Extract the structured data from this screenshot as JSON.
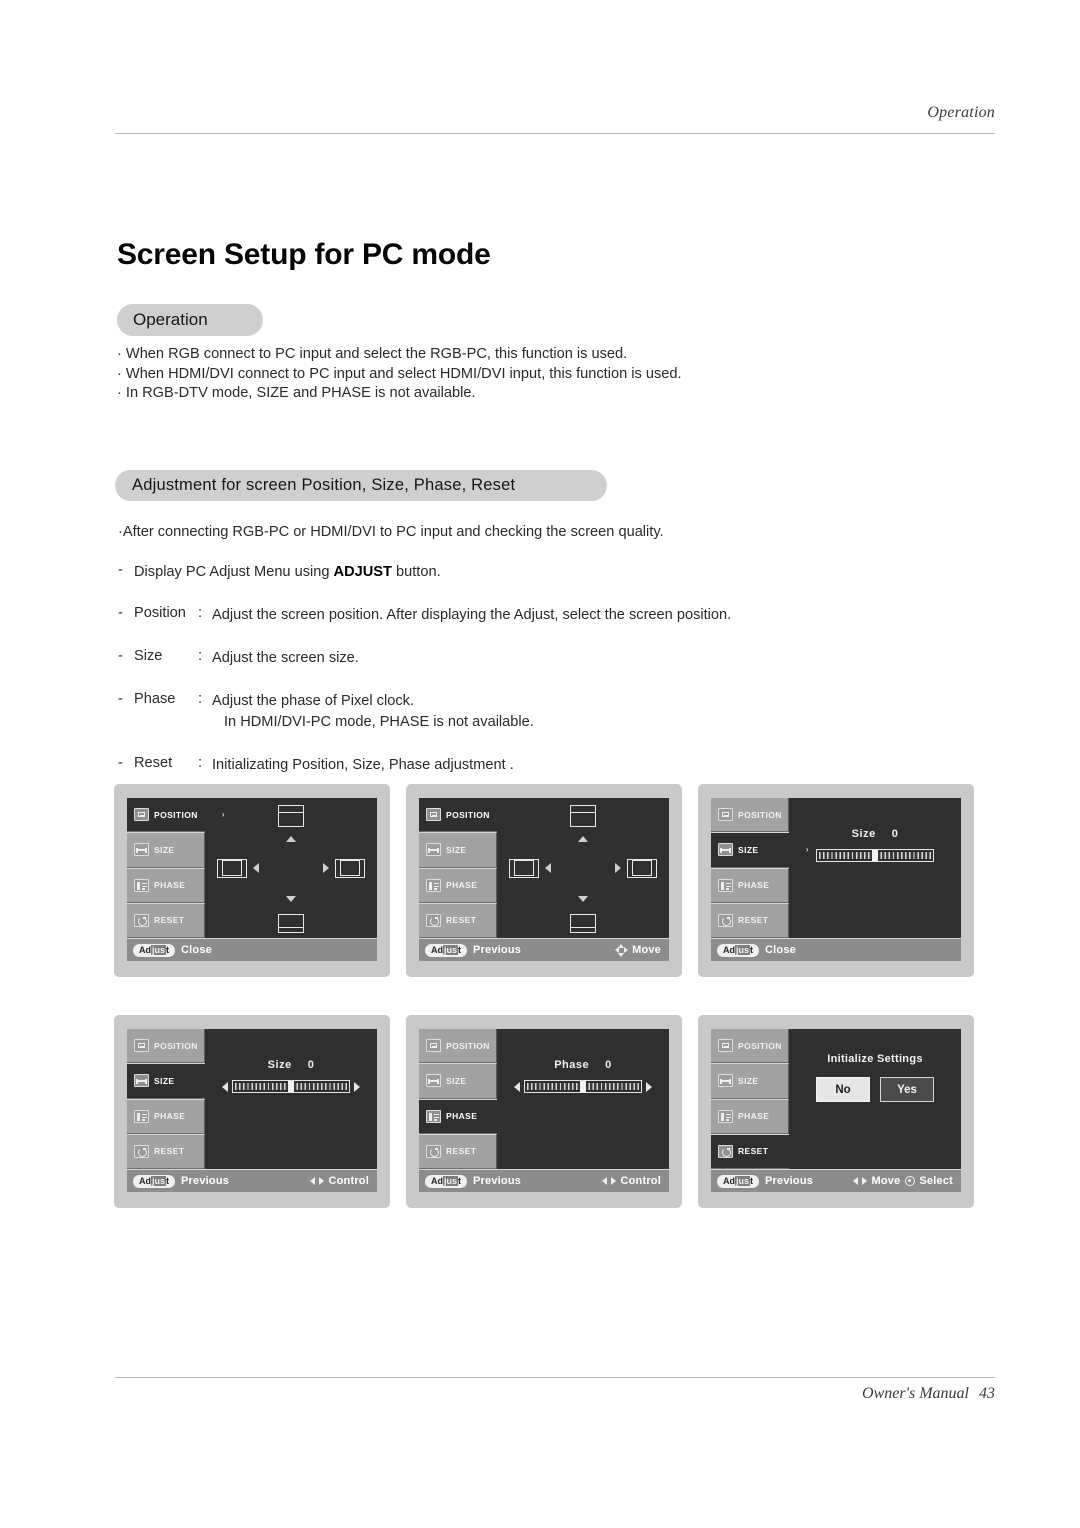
{
  "header": {
    "running_head": "Operation"
  },
  "title": "Screen Setup for PC mode",
  "operation_section": {
    "pill_label": "Operation",
    "bullets": [
      "· When RGB connect to PC input and select the RGB-PC, this function is used.",
      "· When HDMI/DVI connect to PC input and select HDMI/DVI input, this function is used.",
      "· In RGB-DTV mode, SIZE and PHASE is not available."
    ]
  },
  "adjustment_section": {
    "pill_label": "Adjustment for screen Position, Size, Phase, Reset",
    "lead": "·After connecting RGB-PC or HDMI/DVI to PC input and checking the screen quality.",
    "steps": [
      {
        "dash": "-",
        "term": "",
        "colon": "",
        "desc_pre": "Display PC Adjust Menu using ",
        "desc_bold": "ADJUST",
        "desc_post": " button.",
        "desc2": ""
      },
      {
        "dash": "-",
        "term": "Position",
        "colon": ":",
        "desc_pre": "Adjust the screen position. After displaying the Adjust, select the screen position.",
        "desc_bold": "",
        "desc_post": "",
        "desc2": ""
      },
      {
        "dash": "-",
        "term": "Size",
        "colon": ":",
        "desc_pre": "Adjust the screen size.",
        "desc_bold": "",
        "desc_post": "",
        "desc2": ""
      },
      {
        "dash": "-",
        "term": "Phase",
        "colon": ":",
        "desc_pre": "Adjust the phase of Pixel clock.",
        "desc_bold": "",
        "desc_post": "",
        "desc2": "In HDMI/DVI-PC mode, PHASE is not available."
      },
      {
        "dash": "-",
        "term": "Reset",
        "colon": ":",
        "desc_pre": "Initializating Position, Size, Phase adjustment .",
        "desc_bold": "",
        "desc_post": "",
        "desc2": ""
      }
    ]
  },
  "osd_menu_items": {
    "position": "POSITION",
    "size": "SIZE",
    "phase": "PHASE",
    "reset": "RESET"
  },
  "osd_panels": [
    {
      "id": "position-highlight",
      "selected": "position",
      "selected_arrow": "›",
      "content": "position-diagram",
      "bar": {
        "key": "Adjust",
        "action": "Close",
        "hint1": "",
        "hint1_icon": "",
        "hint2": "",
        "hint2_icon": ""
      }
    },
    {
      "id": "position-move",
      "selected": "position",
      "selected_arrow": "",
      "content": "position-diagram",
      "bar": {
        "key": "Adjust",
        "action": "Previous",
        "hint1": "Move",
        "hint1_icon": "four-way-arrow-icon",
        "hint2": "",
        "hint2_icon": ""
      }
    },
    {
      "id": "size-close",
      "selected": "size",
      "selected_arrow": "›",
      "content": "slider",
      "slider": {
        "label": "Size",
        "value": "0",
        "percent": 50,
        "carets": false
      },
      "bar": {
        "key": "Adjust",
        "action": "Close",
        "hint1": "",
        "hint1_icon": "",
        "hint2": "",
        "hint2_icon": ""
      }
    },
    {
      "id": "size-control",
      "selected": "size",
      "selected_arrow": "",
      "content": "slider",
      "slider": {
        "label": "Size",
        "value": "0",
        "percent": 50,
        "carets": true
      },
      "bar": {
        "key": "Adjust",
        "action": "Previous",
        "hint1": "Control",
        "hint1_icon": "left-right-arrow-icon",
        "hint2": "",
        "hint2_icon": ""
      }
    },
    {
      "id": "phase-control",
      "selected": "phase",
      "selected_arrow": "",
      "content": "slider",
      "slider": {
        "label": "Phase",
        "value": "0",
        "percent": 50,
        "carets": true
      },
      "bar": {
        "key": "Adjust",
        "action": "Previous",
        "hint1": "Control",
        "hint1_icon": "left-right-arrow-icon",
        "hint2": "",
        "hint2_icon": ""
      }
    },
    {
      "id": "reset-confirm",
      "selected": "reset",
      "selected_arrow": "",
      "content": "initialize",
      "initialize": {
        "title": "Initialize Settings",
        "no": "No",
        "yes": "Yes",
        "focused": "No"
      },
      "bar": {
        "key": "Adjust",
        "action": "Previous",
        "hint1": "Move",
        "hint1_icon": "left-right-arrow-icon",
        "hint2": "Select",
        "hint2_icon": "ok-circle-icon"
      }
    }
  ],
  "footer": {
    "label": "Owner's Manual",
    "page": "43"
  }
}
